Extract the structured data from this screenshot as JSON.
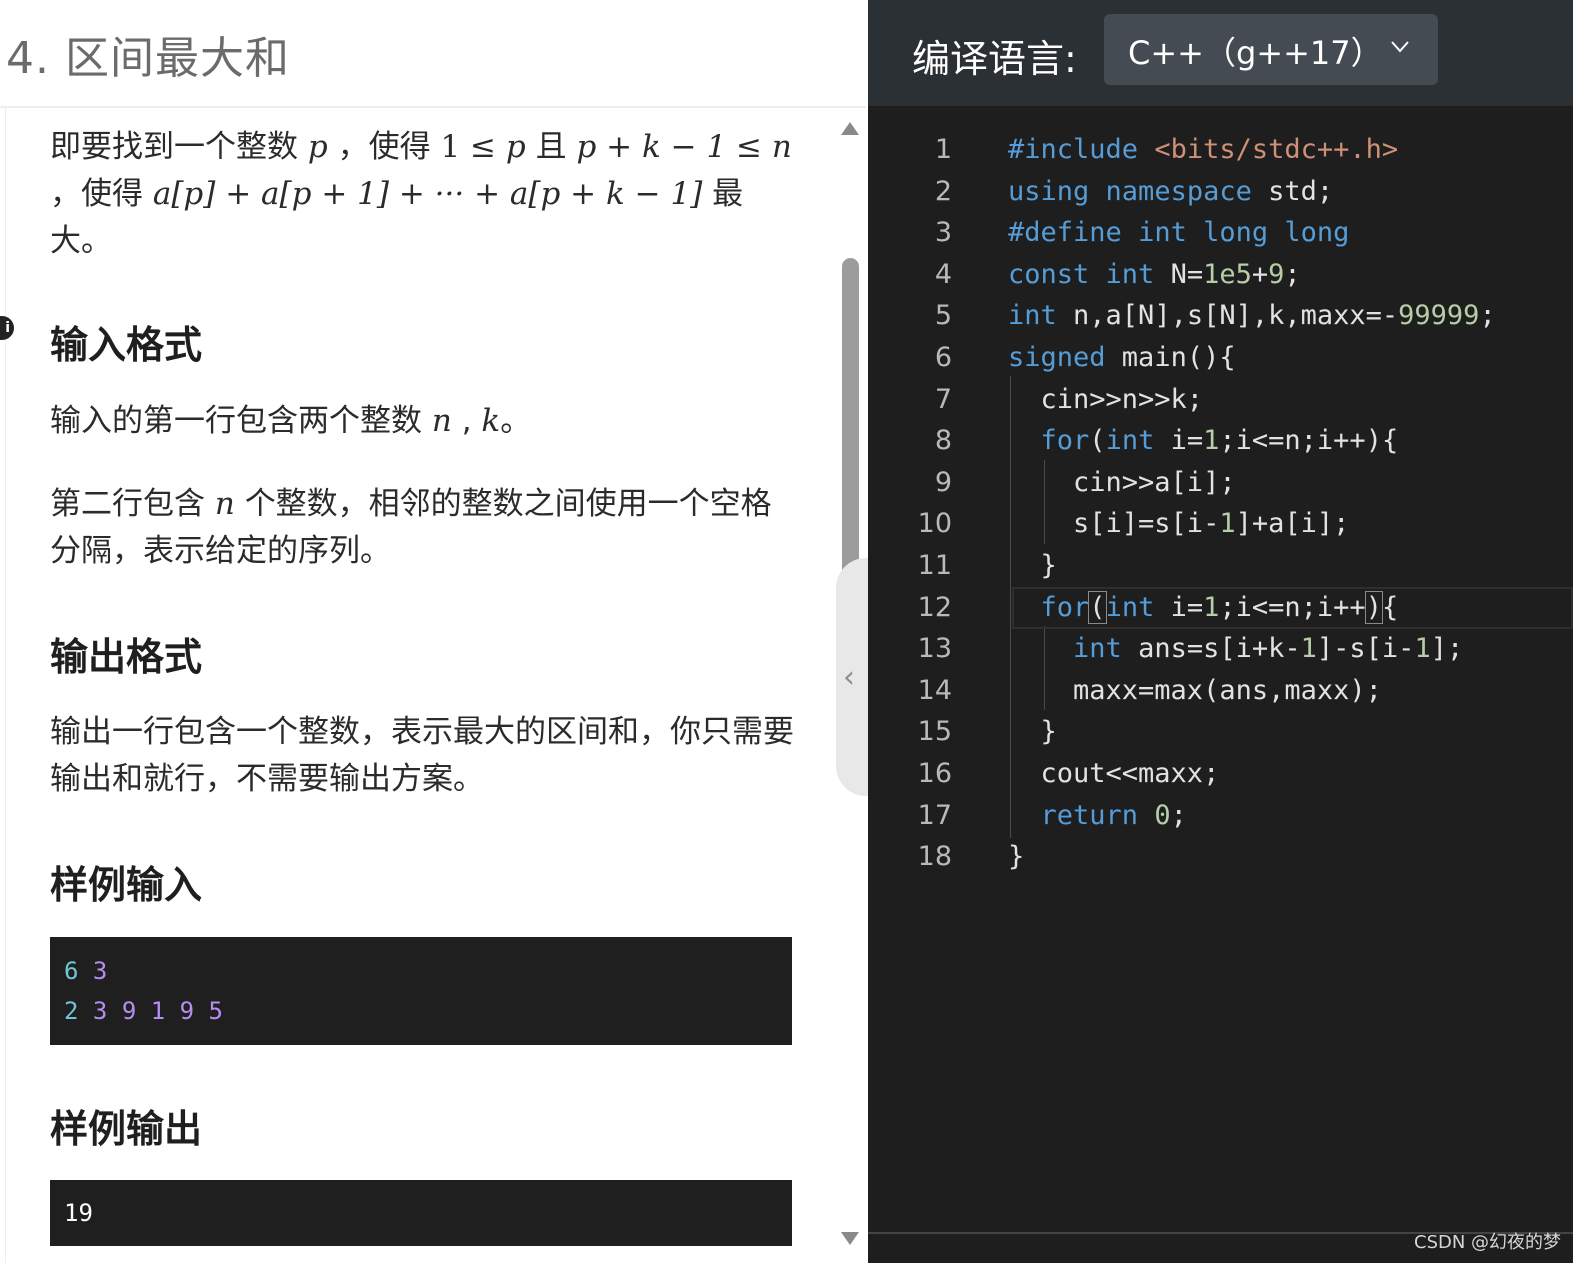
{
  "problem": {
    "title": "4. 区间最大和",
    "intro": {
      "p1": "即要找到一个整数",
      "v_p": "p",
      "p2": "，使得",
      "m1": "1 ≤",
      "p3": "且",
      "m2": "+ k − 1 ≤ n",
      "p4": "，使得",
      "m3": "a[p] + a[p + 1] + ··· + a[p + k − 1]",
      "p5": "最",
      "p6": "大。"
    },
    "input_heading": "输入格式",
    "input_line1_a": "输入的第一行包含两个整数",
    "input_line1_n": "n",
    "input_line1_sep": ",",
    "input_line1_k": "k",
    "input_line1_end": "。",
    "input_line2_a": "第二行包含",
    "input_line2_n": "n",
    "input_line2_b": "个整数，相邻的整数之间使用一个空格",
    "input_line2_c": "分隔，表示给定的序列。",
    "output_heading": "输出格式",
    "output_line1": "输出一行包含一个整数，表示最大的区间和，你只需要",
    "output_line2": "输出和就行，不需要输出方案。",
    "sample_input_heading": "样例输入",
    "sample_input_lines": [
      [
        "6",
        "3"
      ],
      [
        "2",
        "3",
        "9",
        "1",
        "9",
        "5"
      ]
    ],
    "sample_output_heading": "样例输出",
    "sample_output": "19"
  },
  "compiler": {
    "label": "编译语言:",
    "selected": "C++（g++17）"
  },
  "code": {
    "line_numbers": [
      "1",
      "2",
      "3",
      "4",
      "5",
      "6",
      "7",
      "8",
      "9",
      "10",
      "11",
      "12",
      "13",
      "14",
      "15",
      "16",
      "17",
      "18"
    ],
    "l1": [
      "#include",
      " ",
      "<bits/stdc++.h>"
    ],
    "l2": [
      "using",
      " ",
      "namespace",
      " std;"
    ],
    "l3": [
      "#define",
      " ",
      "int",
      " ",
      "long",
      " ",
      "long"
    ],
    "l4": [
      "const",
      " ",
      "int",
      " N=",
      "1e5",
      "+",
      "9",
      ";"
    ],
    "l5": [
      "int",
      " n,a[N],s[N],k,maxx=-",
      "99999",
      ";"
    ],
    "l6": [
      "signed",
      " main(){"
    ],
    "l7": [
      "  cin>>n>>k;"
    ],
    "l8": [
      "  ",
      "for",
      "(",
      "int",
      " i=",
      "1",
      ";i<=n;i++){"
    ],
    "l9": [
      "    cin>>a[i];"
    ],
    "l10": [
      "    s[i]=s[i-",
      "1",
      "]+a[i];"
    ],
    "l11": [
      "  }"
    ],
    "l12": [
      "  ",
      "for",
      "(",
      "int",
      " i=",
      "1",
      ";i<=n;i++",
      ")",
      "{"
    ],
    "l13": [
      "    ",
      "int",
      " ans=s[i+k-",
      "1",
      "]-s[i-",
      "1",
      "];"
    ],
    "l14": [
      "    maxx=max(ans,maxx);"
    ],
    "l15": [
      "  }"
    ],
    "l16": [
      "  cout<<maxx;"
    ],
    "l17": [
      "  ",
      "return",
      " ",
      "0",
      ";"
    ],
    "l18": [
      "}"
    ]
  },
  "watermark": "CSDN @幻夜的梦",
  "colors": {
    "keyword": "#569cd6",
    "include_path": "#ce9178",
    "number": "#b5cea8",
    "editor_bg": "#1e1e1e",
    "toolbar_bg": "#2b3035"
  }
}
